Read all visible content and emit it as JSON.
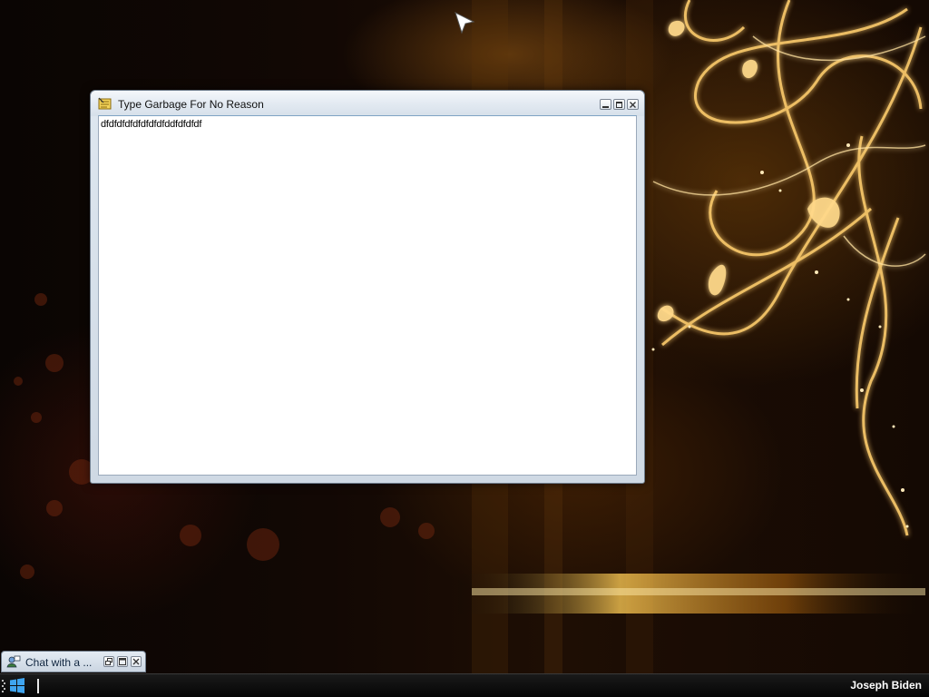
{
  "desktop": {
    "cursor_icon": "arrow-cursor-icon"
  },
  "window": {
    "title": "Type Garbage For No Reason",
    "icon": "notepad-icon",
    "editor_text": "dfdfdfdfdfdfdfdfddfdfdfdf",
    "buttons": {
      "minimize": "minimize-icon",
      "maximize": "maximize-icon",
      "close": "close-icon"
    }
  },
  "minimized_window": {
    "title": "Chat with a ...",
    "icon": "chat-icon",
    "buttons": [
      "restore-icon",
      "maximize-icon",
      "close-icon"
    ]
  },
  "taskbar": {
    "start_icon": "windows-logo-icon",
    "user_name": "Joseph Biden"
  },
  "colors": {
    "window_frame": "#dde6ef",
    "taskbar": "#0a0a0a",
    "wallpaper_accent": "#f5c060"
  }
}
